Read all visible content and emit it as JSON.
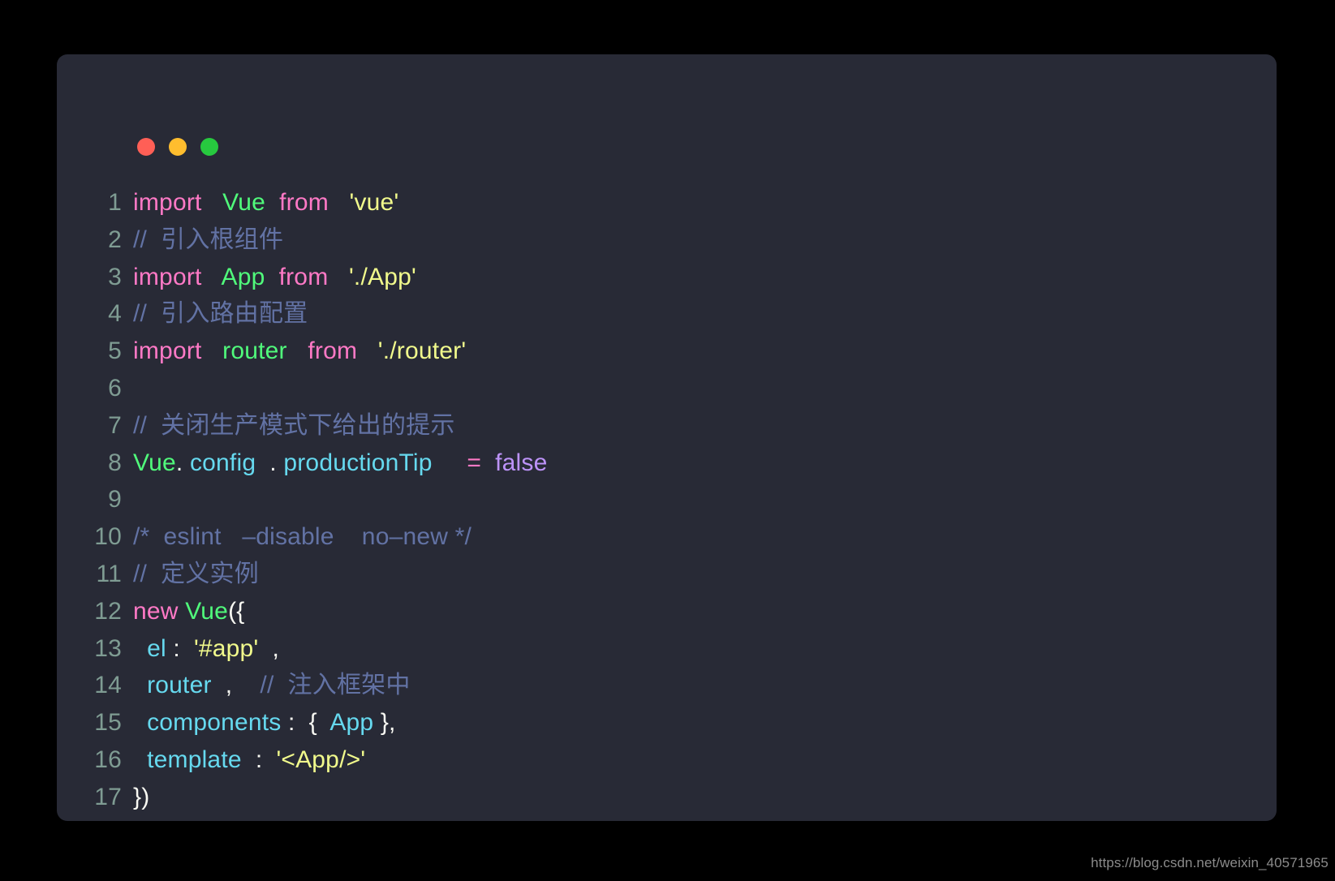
{
  "window": {
    "title_bar": {
      "buttons": [
        {
          "name": "close",
          "color": "#ff5f56"
        },
        {
          "name": "minimize",
          "color": "#ffbd2e"
        },
        {
          "name": "maximize",
          "color": "#27c93f"
        }
      ]
    },
    "background_color": "#282a36",
    "page_background_color": "#000000"
  },
  "editor": {
    "language": "javascript",
    "theme_colors": {
      "background": "#282a36",
      "foreground": "#f8f8f2",
      "line_number": "#7f9c93",
      "keyword": "#ff79c6",
      "class_name": "#50fa7b",
      "string": "#f1fa8c",
      "comment": "#6272a4",
      "property": "#66d9ef",
      "constant": "#bd93f9"
    },
    "lines": [
      {
        "number": "1",
        "tokens": [
          {
            "t": "import",
            "c": "kw"
          },
          {
            "t": "   ",
            "c": "punc"
          },
          {
            "t": "Vue",
            "c": "cls"
          },
          {
            "t": "  ",
            "c": "punc"
          },
          {
            "t": "from",
            "c": "kw"
          },
          {
            "t": "   ",
            "c": "punc"
          },
          {
            "t": "'vue'",
            "c": "str"
          }
        ]
      },
      {
        "number": "2",
        "tokens": [
          {
            "t": "//  引入根组件",
            "c": "com"
          }
        ]
      },
      {
        "number": "3",
        "tokens": [
          {
            "t": "import",
            "c": "kw"
          },
          {
            "t": "   ",
            "c": "punc"
          },
          {
            "t": "App",
            "c": "cls"
          },
          {
            "t": "  ",
            "c": "punc"
          },
          {
            "t": "from",
            "c": "kw"
          },
          {
            "t": "   ",
            "c": "punc"
          },
          {
            "t": "'./App'",
            "c": "str"
          }
        ]
      },
      {
        "number": "4",
        "tokens": [
          {
            "t": "//  引入路由配置",
            "c": "com"
          }
        ]
      },
      {
        "number": "5",
        "tokens": [
          {
            "t": "import",
            "c": "kw"
          },
          {
            "t": "   ",
            "c": "punc"
          },
          {
            "t": "router",
            "c": "cls"
          },
          {
            "t": "   ",
            "c": "punc"
          },
          {
            "t": "from",
            "c": "kw"
          },
          {
            "t": "   ",
            "c": "punc"
          },
          {
            "t": "'./router'",
            "c": "str"
          }
        ]
      },
      {
        "number": "6",
        "tokens": []
      },
      {
        "number": "7",
        "tokens": [
          {
            "t": "//  关闭生产模式下给出的提示",
            "c": "com"
          }
        ]
      },
      {
        "number": "8",
        "tokens": [
          {
            "t": "Vue",
            "c": "cls"
          },
          {
            "t": ".",
            "c": "punc"
          },
          {
            "t": " config",
            "c": "prop"
          },
          {
            "t": "  . ",
            "c": "punc"
          },
          {
            "t": "productionTip",
            "c": "prop"
          },
          {
            "t": "     ",
            "c": "punc"
          },
          {
            "t": "=",
            "c": "kw"
          },
          {
            "t": "  ",
            "c": "punc"
          },
          {
            "t": "false",
            "c": "const"
          }
        ]
      },
      {
        "number": "9",
        "tokens": []
      },
      {
        "number": "10",
        "tokens": [
          {
            "t": "/*  eslint   –disable    no–new */",
            "c": "com"
          }
        ]
      },
      {
        "number": "11",
        "tokens": [
          {
            "t": "//  定义实例",
            "c": "com"
          }
        ]
      },
      {
        "number": "12",
        "tokens": [
          {
            "t": "new",
            "c": "kw"
          },
          {
            "t": " ",
            "c": "punc"
          },
          {
            "t": "Vue",
            "c": "cls"
          },
          {
            "t": "({",
            "c": "punc"
          }
        ]
      },
      {
        "number": "13",
        "tokens": [
          {
            "t": "  ",
            "c": "punc"
          },
          {
            "t": "el",
            "c": "prop"
          },
          {
            "t": " : ",
            "c": "punc"
          },
          {
            "t": " '#app'",
            "c": "str"
          },
          {
            "t": "  ,",
            "c": "punc"
          }
        ]
      },
      {
        "number": "14",
        "tokens": [
          {
            "t": "  ",
            "c": "punc"
          },
          {
            "t": "router",
            "c": "prop"
          },
          {
            "t": "  ,",
            "c": "punc"
          },
          {
            "t": "    ",
            "c": "punc"
          },
          {
            "t": "//  注入框架中",
            "c": "com"
          }
        ]
      },
      {
        "number": "15",
        "tokens": [
          {
            "t": "  ",
            "c": "punc"
          },
          {
            "t": "components",
            "c": "prop"
          },
          {
            "t": " :",
            "c": "punc"
          },
          {
            "t": "  {  ",
            "c": "punc"
          },
          {
            "t": "App",
            "c": "prop"
          },
          {
            "t": " },",
            "c": "punc"
          }
        ]
      },
      {
        "number": "16",
        "tokens": [
          {
            "t": "  ",
            "c": "punc"
          },
          {
            "t": "template",
            "c": "prop"
          },
          {
            "t": "  :  ",
            "c": "punc"
          },
          {
            "t": "'<App/>'",
            "c": "str"
          }
        ]
      },
      {
        "number": "17",
        "tokens": [
          {
            "t": "})",
            "c": "punc"
          }
        ]
      }
    ]
  },
  "watermark": {
    "text": "https://blog.csdn.net/weixin_40571965"
  }
}
